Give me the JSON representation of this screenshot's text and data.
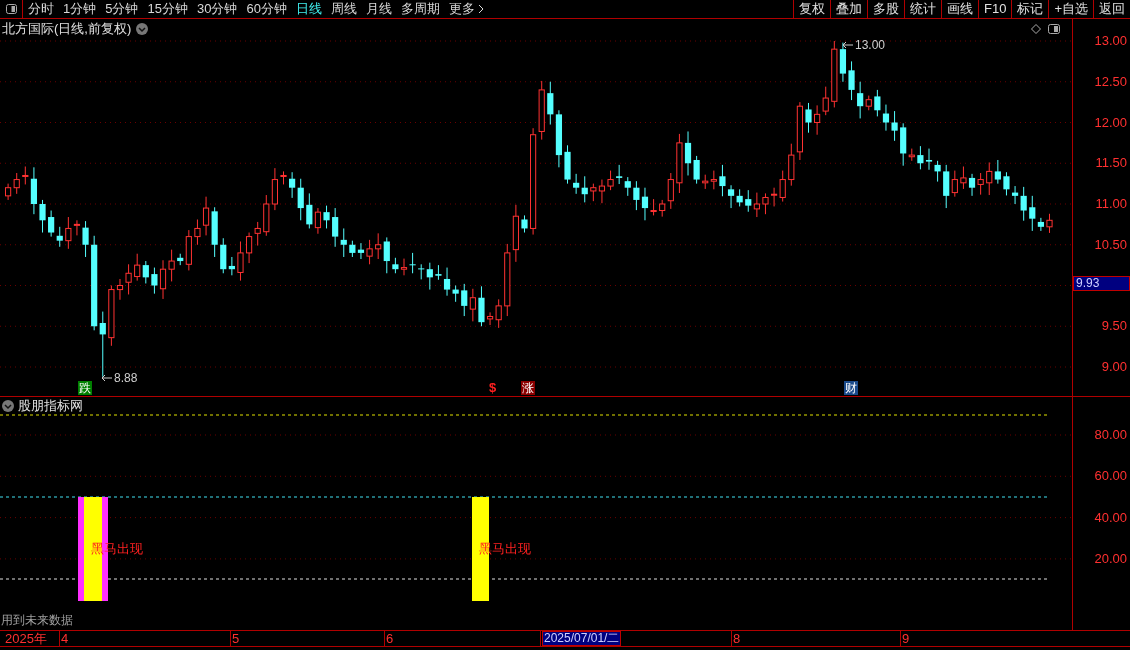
{
  "toolbar": {
    "tabs": [
      {
        "label": "分时",
        "selected": false
      },
      {
        "label": "1分钟",
        "selected": false
      },
      {
        "label": "5分钟",
        "selected": false
      },
      {
        "label": "15分钟",
        "selected": false
      },
      {
        "label": "30分钟",
        "selected": false
      },
      {
        "label": "60分钟",
        "selected": false
      },
      {
        "label": "日线",
        "selected": true
      },
      {
        "label": "周线",
        "selected": false
      },
      {
        "label": "月线",
        "selected": false
      },
      {
        "label": "多周期",
        "selected": false
      },
      {
        "label": "更多",
        "selected": false
      }
    ],
    "buttons": [
      "复权",
      "叠加",
      "多股",
      "统计",
      "画线",
      "F10",
      "标记",
      "+自选",
      "返回"
    ]
  },
  "price_chart": {
    "title": "北方国际(日线,前复权)",
    "yticks": [
      "13.00",
      "12.50",
      "12.00",
      "11.50",
      "11.00",
      "10.50",
      "9.50",
      "9.00"
    ],
    "current_price": "9.93",
    "high_label": "13.00",
    "low_label": "8.88",
    "markers": [
      {
        "kind": "badge",
        "text": "跌",
        "color": "#008000"
      },
      {
        "kind": "symbol",
        "text": "$",
        "color": "#ff2020"
      },
      {
        "kind": "badge",
        "text": "涨",
        "color": "#8b0000"
      },
      {
        "kind": "badge",
        "text": "财",
        "color": "#1a4a8a"
      }
    ]
  },
  "indicator": {
    "title": "股朋指标网",
    "yticks": [
      "80.00",
      "60.00",
      "40.00",
      "20.00"
    ],
    "signals": [
      "黑马出现",
      "黑马出现"
    ],
    "note": "用到未来数据"
  },
  "date_axis": {
    "year": "2025年",
    "months": [
      "4",
      "5",
      "6",
      "2025/07/01/二",
      "8",
      "9"
    ]
  }
}
